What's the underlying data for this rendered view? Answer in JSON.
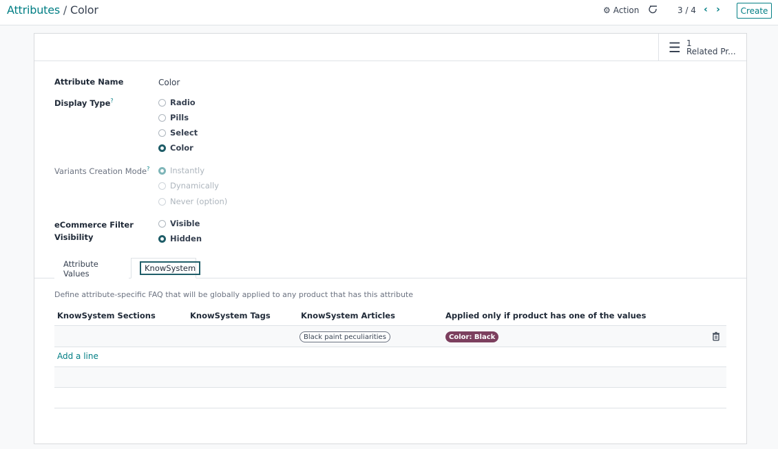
{
  "breadcrumb": {
    "parent": "Attributes",
    "separator": "/",
    "current": "Color"
  },
  "toolbar": {
    "action_label": "Action",
    "pager_value": "3 / 4",
    "create_label": "Create"
  },
  "smart_button": {
    "count": "1",
    "label": "Related Pr..."
  },
  "fields": {
    "attribute_name": {
      "label": "Attribute Name",
      "value": "Color"
    },
    "display_type": {
      "label": "Display Type",
      "help": "?",
      "options": [
        "Radio",
        "Pills",
        "Select",
        "Color"
      ],
      "selected": "Color"
    },
    "variants_creation_mode": {
      "label": "Variants Creation Mode",
      "help": "?",
      "options": [
        "Instantly",
        "Dynamically",
        "Never (option)"
      ],
      "selected": "Instantly"
    },
    "ecommerce_filter_visibility": {
      "label_line1": "eCommerce Filter",
      "label_line2": "Visibility",
      "options": [
        "Visible",
        "Hidden"
      ],
      "selected": "Hidden"
    }
  },
  "tabs": [
    {
      "label": "Attribute Values",
      "active": false
    },
    {
      "label": "KnowSystem",
      "active": true
    }
  ],
  "knowsystem": {
    "description": "Define attribute-specific FAQ that will be globally applied to any product that has this attribute",
    "columns": [
      "KnowSystem Sections",
      "KnowSystem Tags",
      "KnowSystem Articles",
      "Applied only if product has one of the values"
    ],
    "rows": [
      {
        "sections": "",
        "tags": "",
        "article": "Black paint peculiarities",
        "value": "Color: Black"
      }
    ],
    "add_line_label": "Add a line"
  },
  "colors": {
    "primary": "#017e84",
    "tag_value": "#7c3f5e",
    "radio_checked": "#1f5d68"
  },
  "icons": {
    "action": "gear-icon",
    "reset": "reset-icon",
    "pager_prev": "chevron-left-icon",
    "pager_next": "chevron-right-icon",
    "smart_button": "list-icon",
    "row_delete": "trash-icon"
  }
}
